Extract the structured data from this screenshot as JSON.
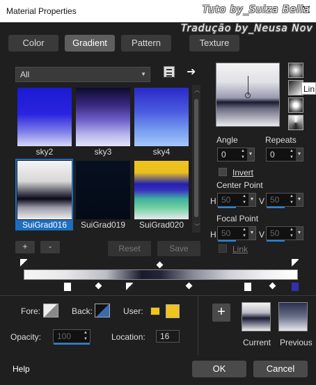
{
  "window": {
    "title": "Material Properties",
    "close_icon": "close-icon"
  },
  "watermark": {
    "line1": "Tuto by_Suiza Bella",
    "line2": "Tradução by_Neusa Nov"
  },
  "tabs": [
    {
      "label": "Color",
      "active": false
    },
    {
      "label": "Gradient",
      "active": true
    },
    {
      "label": "Pattern",
      "active": false
    },
    {
      "label": "Texture",
      "active": false
    }
  ],
  "category": {
    "selected": "All"
  },
  "gradients": [
    {
      "name": "sky2",
      "selected": false
    },
    {
      "name": "sky3",
      "selected": false
    },
    {
      "name": "sky4",
      "selected": false
    },
    {
      "name": "SuiGrad016",
      "selected": true
    },
    {
      "name": "SuiGrad019",
      "selected": false
    },
    {
      "name": "SuiGrad020",
      "selected": false
    }
  ],
  "list_buttons": {
    "add": "+",
    "remove": "-",
    "reset": "Reset",
    "save": "Save"
  },
  "style_tooltip": "Lin",
  "angle": {
    "label": "Angle",
    "value": "0"
  },
  "repeats": {
    "label": "Repeats",
    "value": "0"
  },
  "invert": {
    "label": "Invert"
  },
  "center_point": {
    "label": "Center Point",
    "h_label": "H",
    "h": "50",
    "v_label": "V",
    "v": "50"
  },
  "focal_point": {
    "label": "Focal Point",
    "h_label": "H",
    "h": "50",
    "v_label": "V",
    "v": "50"
  },
  "link": {
    "label": "Link"
  },
  "fore": {
    "label": "Fore:"
  },
  "back": {
    "label": "Back:"
  },
  "user": {
    "label": "User:",
    "color": "#f2c31c"
  },
  "opacity": {
    "label": "Opacity:",
    "value": "100"
  },
  "location": {
    "label": "Location:",
    "value": "16"
  },
  "preview": {
    "current": "Current",
    "previous": "Previous",
    "add": "+"
  },
  "footer": {
    "help": "Help",
    "ok": "OK",
    "cancel": "Cancel"
  }
}
